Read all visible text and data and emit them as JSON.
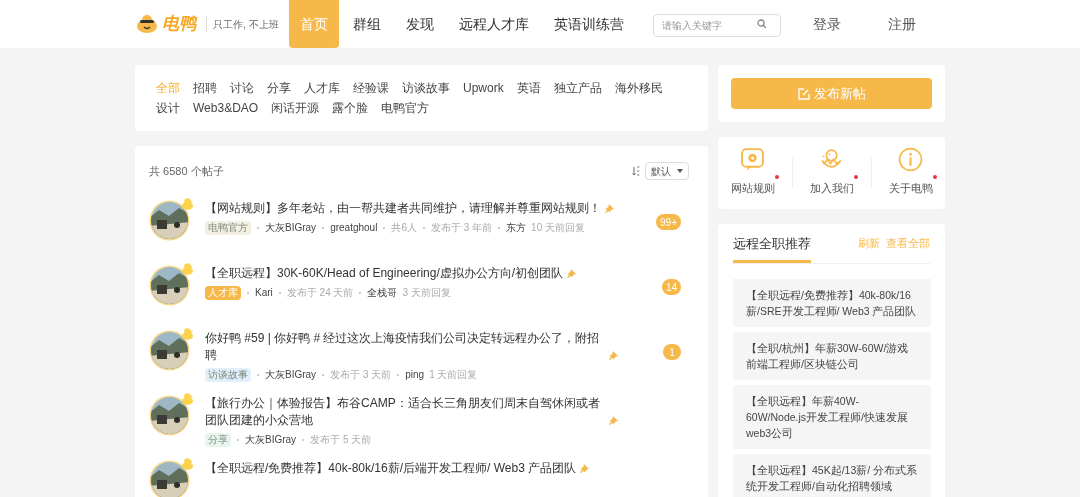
{
  "header": {
    "logo": "电鸭",
    "slogan": "只工作, 不上班",
    "nav": [
      {
        "label": "首页",
        "selected": true
      },
      {
        "label": "群组",
        "selected": false
      },
      {
        "label": "发现",
        "selected": false
      },
      {
        "label": "远程人才库",
        "selected": false
      },
      {
        "label": "英语训练营",
        "selected": false
      }
    ],
    "search": {
      "placeholder": "请输入关键字"
    },
    "login": "登录",
    "register": "注册"
  },
  "categories": [
    {
      "label": "全部",
      "selected": true
    },
    {
      "label": "招聘",
      "selected": false
    },
    {
      "label": "讨论",
      "selected": false
    },
    {
      "label": "分享",
      "selected": false
    },
    {
      "label": "人才库",
      "selected": false
    },
    {
      "label": "经验课",
      "selected": false
    },
    {
      "label": "访谈故事",
      "selected": false
    },
    {
      "label": "Upwork",
      "selected": false
    },
    {
      "label": "英语",
      "selected": false
    },
    {
      "label": "独立产品",
      "selected": false
    },
    {
      "label": "海外移民",
      "selected": false
    },
    {
      "label": "设计",
      "selected": false
    },
    {
      "label": "Web3&DAO",
      "selected": false
    },
    {
      "label": "闲话开源",
      "selected": false
    },
    {
      "label": "露个脸",
      "selected": false
    },
    {
      "label": "电鸭官方",
      "selected": false
    }
  ],
  "posts_header": {
    "total": "共 6580 个帖子",
    "sort": "默认"
  },
  "posts": [
    {
      "title": "【网站规则】多年老站，由一帮共建者共同维护，请理解并尊重网站规则！",
      "tag": {
        "label": "电鸭官方",
        "color": "#f3efe2"
      },
      "meta": [
        {
          "text": "大灰BIGray",
          "kind": "name"
        },
        {
          "text": "greatghoul",
          "kind": "name"
        },
        {
          "text": "共6人",
          "kind": "info"
        },
        {
          "text": "发布于 3 年前",
          "kind": "info"
        },
        {
          "text": "东方",
          "kind": "name"
        },
        {
          "text": "10 天前回复",
          "kind": "reply"
        }
      ],
      "count": "99+"
    },
    {
      "title": "【全职远程】30K-60K/Head of Engineering/虚拟办公方向/初创团队",
      "tag": {
        "label": "人才库",
        "color": "#f7b84a"
      },
      "meta": [
        {
          "text": "Kari",
          "kind": "name"
        },
        {
          "text": "发布于 24 天前",
          "kind": "info"
        },
        {
          "text": "全栈哥",
          "kind": "name"
        },
        {
          "text": "3 天前回复",
          "kind": "reply"
        }
      ],
      "count": "14"
    },
    {
      "title": "你好鸭 #59 | 你好鸭 # 经过这次上海疫情我们公司决定转远程办公了，附招聘",
      "tag": {
        "label": "访谈故事",
        "color": "#e3f0fc"
      },
      "meta": [
        {
          "text": "大灰BIGray",
          "kind": "name"
        },
        {
          "text": "发布于 3 天前",
          "kind": "info"
        },
        {
          "text": "ping",
          "kind": "name"
        },
        {
          "text": "1 天前回复",
          "kind": "reply"
        }
      ],
      "count": "1"
    },
    {
      "title": "【旅行办公｜体验报告】布谷CAMP：适合长三角朋友们周末自驾休闲或者团队团建的小众营地",
      "tag": {
        "label": "分享",
        "color": "#e6f5ee"
      },
      "meta": [
        {
          "text": "大灰BIGray",
          "kind": "name"
        },
        {
          "text": "发布于 5 天前",
          "kind": "info"
        }
      ]
    },
    {
      "title": "【全职远程/免费推荐】40k-80k/16薪/后端开发工程师/ Web3 产品团队"
    }
  ],
  "sidebar": {
    "new_post": "发布新帖",
    "links": [
      {
        "label": "网站规则",
        "dot": true
      },
      {
        "label": "加入我们",
        "dot": true
      },
      {
        "label": "关于电鸭",
        "dot": true
      }
    ],
    "recommend": {
      "title": "远程全职推荐",
      "refresh": "刷新",
      "view_all": "查看全部",
      "items": [
        "【全职远程/免费推荐】40k-80k/16薪/SRE开发工程师/ Web3 产品团队",
        "【全职/杭州】年薪30W-60W/游戏前端工程师/区块链公司",
        "【全职远程】年薪40W-60W/Node.js开发工程师/快速发展web3公司",
        "【全职远程】45K起/13薪/ 分布式系统开发工程师/自动化招聘领域"
      ]
    }
  }
}
